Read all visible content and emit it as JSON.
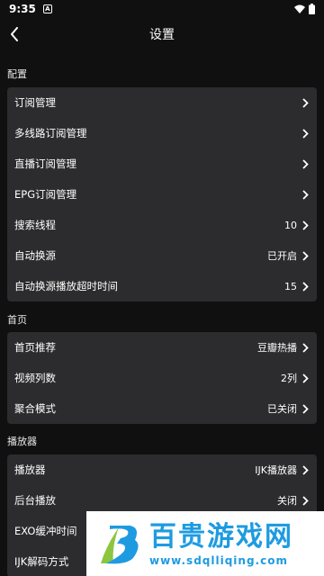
{
  "status_bar": {
    "time": "9:35",
    "notif_letter": "A"
  },
  "header": {
    "title": "设置"
  },
  "sections": [
    {
      "label": "配置",
      "rows": [
        {
          "label": "订阅管理",
          "value": ""
        },
        {
          "label": "多线路订阅管理",
          "value": ""
        },
        {
          "label": "直播订阅管理",
          "value": ""
        },
        {
          "label": "EPG订阅管理",
          "value": ""
        },
        {
          "label": "搜索线程",
          "value": "10"
        },
        {
          "label": "自动换源",
          "value": "已开启"
        },
        {
          "label": "自动换源播放超时时间",
          "value": "15"
        }
      ]
    },
    {
      "label": "首页",
      "rows": [
        {
          "label": "首页推荐",
          "value": "豆瓣热播"
        },
        {
          "label": "视频列数",
          "value": "2列"
        },
        {
          "label": "聚合模式",
          "value": "已关闭"
        }
      ]
    },
    {
      "label": "播放器",
      "rows": [
        {
          "label": "播放器",
          "value": "IJK播放器"
        },
        {
          "label": "后台播放",
          "value": "关闭"
        },
        {
          "label": "EXO缓冲时间",
          "value": ""
        },
        {
          "label": "IJK解码方式",
          "value": ""
        }
      ]
    }
  ],
  "watermark": {
    "name": "百贵游戏网",
    "url": "www.sdqlliqing.com"
  },
  "colors": {
    "background": "#101010",
    "card": "#2c2c2e",
    "text": "#ffffff",
    "watermark_blue": "#1e9be0"
  }
}
